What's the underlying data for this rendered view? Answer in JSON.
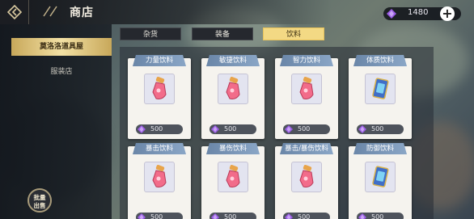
{
  "header": {
    "title": "商店"
  },
  "currency": {
    "amount": "1480",
    "icon": "purple-gem-icon",
    "add_icon": "plus-icon"
  },
  "sidebar": {
    "items": [
      {
        "label": "莫洛洛道具屋",
        "active": true
      },
      {
        "label": "服装店",
        "active": false
      }
    ],
    "batch_button": {
      "line1": "批量",
      "line2": "出售"
    }
  },
  "tabs": [
    {
      "label": "杂货",
      "active": false
    },
    {
      "label": "装备",
      "active": false
    },
    {
      "label": "饮料",
      "active": true
    }
  ],
  "products": [
    {
      "name": "力量饮料",
      "price": "500",
      "icon": "pink-potion-icon"
    },
    {
      "name": "敏捷饮料",
      "price": "500",
      "icon": "pink-potion-icon"
    },
    {
      "name": "智力饮料",
      "price": "500",
      "icon": "pink-potion-icon"
    },
    {
      "name": "体质饮料",
      "price": "500",
      "icon": "blue-card-icon"
    },
    {
      "name": "暴击饮料",
      "price": "500",
      "icon": "pink-potion-icon"
    },
    {
      "name": "暴伤饮料",
      "price": "500",
      "icon": "pink-potion-icon"
    },
    {
      "name": "暴击/暴伤饮料",
      "price": "500",
      "icon": "pink-potion-icon"
    },
    {
      "name": "防御饮料",
      "price": "500",
      "icon": "blue-card-icon"
    }
  ],
  "colors": {
    "accent_gold": "#f3d984",
    "card_title_blue": "#7a96b8",
    "gem_purple": "#9b5de5"
  }
}
